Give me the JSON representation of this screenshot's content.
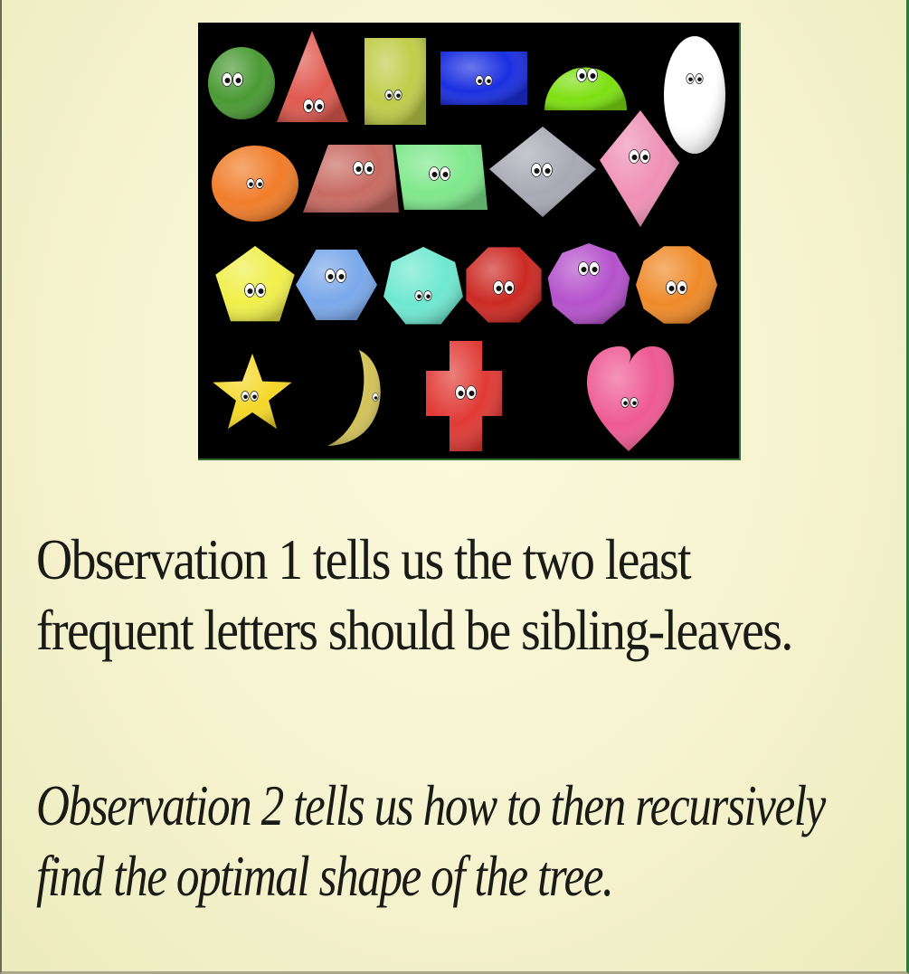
{
  "slide": {
    "observation_1": {
      "line_1": "Observation 1 tells us the two least",
      "line_2": "frequent letters should be sibling-leaves."
    },
    "observation_2": {
      "line_1": "Observation 2 tells us how to then recursively",
      "line_2": "find the optimal shape of the tree."
    }
  },
  "illustration": {
    "background": "#000000",
    "shapes": [
      {
        "name": "circle",
        "color": "#4a9a35"
      },
      {
        "name": "triangle",
        "color": "#e05a50"
      },
      {
        "name": "rectangle",
        "color": "#bfcd4a"
      },
      {
        "name": "wide-rectangle",
        "color": "#1a2fe0"
      },
      {
        "name": "semicircle",
        "color": "#7de012"
      },
      {
        "name": "oval",
        "color": "#ffffff"
      },
      {
        "name": "ellipse",
        "color": "#f07d2a"
      },
      {
        "name": "trapezoid",
        "color": "#c86b62"
      },
      {
        "name": "parallelogram",
        "color": "#7fe88c"
      },
      {
        "name": "rhombus",
        "color": "#a9a9b5"
      },
      {
        "name": "kite",
        "color": "#ef90b5"
      },
      {
        "name": "pentagon",
        "color": "#f0ef4a"
      },
      {
        "name": "hexagon",
        "color": "#7aa8ea"
      },
      {
        "name": "heptagon",
        "color": "#6fe8d0"
      },
      {
        "name": "octagon",
        "color": "#cc2a24"
      },
      {
        "name": "nonagon",
        "color": "#b552cc"
      },
      {
        "name": "decagon",
        "color": "#ef8a2a"
      },
      {
        "name": "star",
        "color": "#f5d82a"
      },
      {
        "name": "crescent",
        "color": "#d2c25a"
      },
      {
        "name": "cross",
        "color": "#e03a35"
      },
      {
        "name": "heart",
        "color": "#ee5a92"
      }
    ]
  }
}
